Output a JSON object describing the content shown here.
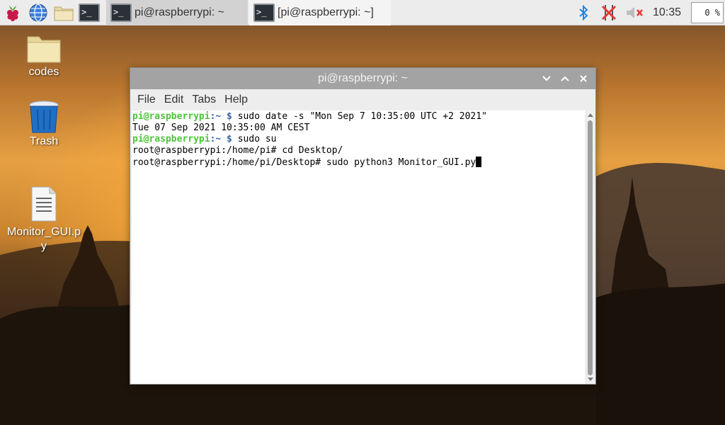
{
  "taskbar": {
    "tasks": [
      {
        "label": "pi@raspberrypi: ~",
        "active": true
      },
      {
        "label": "[pi@raspberrypi: ~]",
        "active": false
      }
    ],
    "clock": "10:35",
    "cpu": "0 %",
    "icons": [
      "raspberry-menu-icon",
      "web-browser-icon",
      "file-manager-icon",
      "terminal-icon",
      "bluetooth-icon",
      "network-disconnected-icon",
      "volume-muted-icon"
    ]
  },
  "desktop": {
    "icons": [
      {
        "label": "codes",
        "icon": "folder-icon"
      },
      {
        "label": "Trash",
        "icon": "trash-icon"
      },
      {
        "label": "Monitor_GUI.py",
        "icon": "text-file-icon"
      }
    ]
  },
  "window": {
    "title": "pi@raspberrypi: ~",
    "menu": [
      "File",
      "Edit",
      "Tabs",
      "Help"
    ]
  },
  "terminal": {
    "lines": [
      {
        "user": "pi@raspberrypi",
        "path": ":~ $",
        "cmd": " sudo date -s \"Mon Sep 7 10:35:00 UTC +2 2021\""
      },
      {
        "text": "Tue 07 Sep 2021 10:35:00 AM CEST"
      },
      {
        "user": "pi@raspberrypi",
        "path": ":~ $",
        "cmd": " sudo su"
      },
      {
        "text": "root@raspberrypi:/home/pi# cd Desktop/"
      },
      {
        "text": "root@raspberrypi:/home/pi/Desktop# sudo python3 Monitor_GUI.py"
      }
    ]
  },
  "colors": {
    "prompt_user": "#4ec33b",
    "prompt_path": "#3465a4",
    "titlebar": "#a3a3a3",
    "taskbar": "#ececec"
  }
}
